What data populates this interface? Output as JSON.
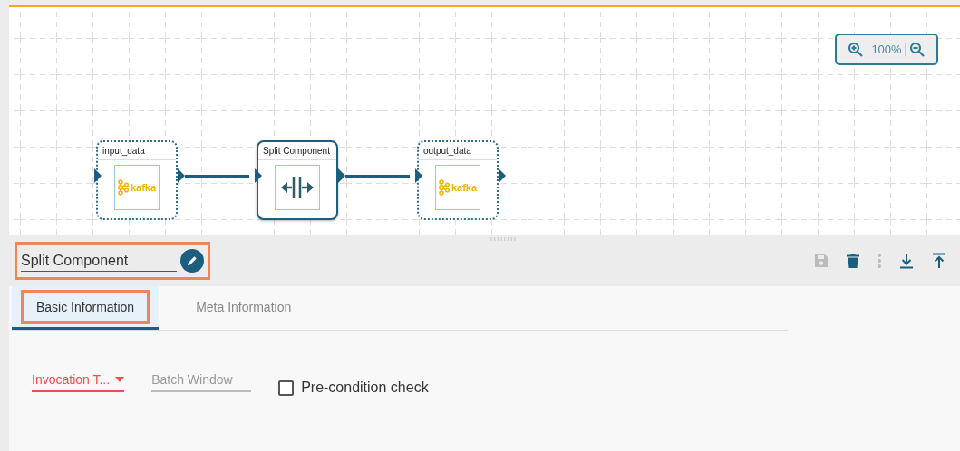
{
  "canvas": {
    "nodes": [
      {
        "title": "input_data",
        "kind": "kafka",
        "logo_text": "kafka",
        "selected": false
      },
      {
        "title": "Split Component",
        "kind": "split",
        "selected": true
      },
      {
        "title": "output_data",
        "kind": "kafka",
        "logo_text": "kafka",
        "selected": false
      }
    ],
    "zoom": {
      "value": "100%"
    }
  },
  "panel": {
    "name_field": {
      "value": "Split Component",
      "highlighted": true
    },
    "toolbar": [
      {
        "kind": "save",
        "disabled": true
      },
      {
        "kind": "delete",
        "disabled": false
      },
      {
        "kind": "more",
        "disabled": true
      },
      {
        "kind": "download",
        "disabled": false
      },
      {
        "kind": "upload",
        "disabled": false
      }
    ],
    "tabs": [
      {
        "label": "Basic Information",
        "selected": true,
        "highlighted": true
      },
      {
        "label": "Meta Information",
        "selected": false,
        "highlighted": false
      }
    ],
    "fields": [
      {
        "kind": "dropdown",
        "value": "Invocation T...",
        "invalid": true
      },
      {
        "kind": "text",
        "placeholder": "Batch Window"
      },
      {
        "kind": "checkbox",
        "label": "Pre-condition check",
        "checked": false
      }
    ]
  }
}
